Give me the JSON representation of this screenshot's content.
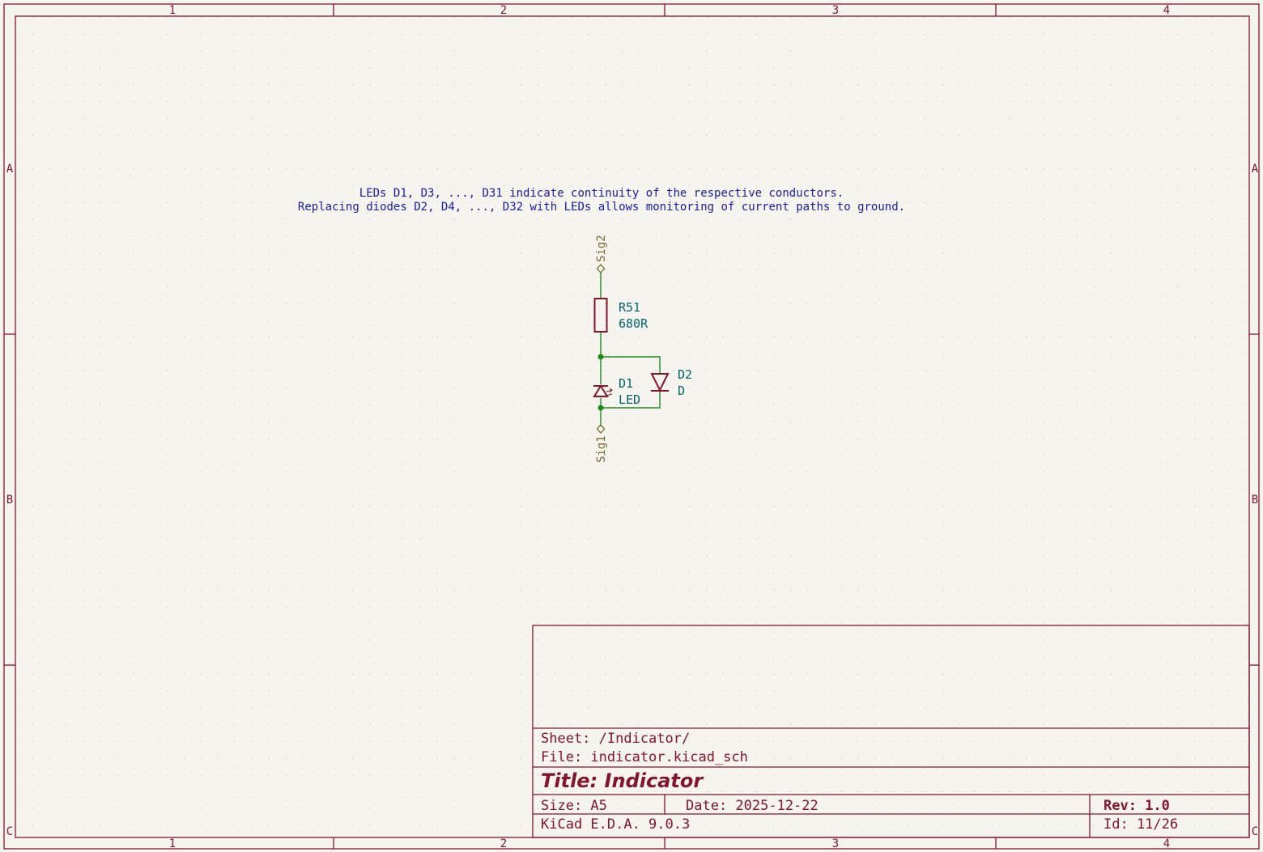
{
  "frame": {
    "columns": [
      "1",
      "2",
      "3",
      "4"
    ],
    "rows": [
      "A",
      "B",
      "C"
    ]
  },
  "note": {
    "line1": "LEDs D1, D3, ..., D31 indicate continuity of the respective conductors.",
    "line2": "Replacing diodes D2, D4, ..., D32 with LEDs allows monitoring of current paths to ground."
  },
  "components": {
    "r51": {
      "ref": "R51",
      "value": "680R"
    },
    "d1": {
      "ref": "D1",
      "value": "LED"
    },
    "d2": {
      "ref": "D2",
      "value": "D"
    }
  },
  "labels": {
    "sig2": "Sig2",
    "sig1": "Sig1"
  },
  "title_block": {
    "sheet": "Sheet: /Indicator/",
    "file": "File: indicator.kicad_sch",
    "title": "Title: Indicator",
    "size": "Size: A5",
    "date": "Date: 2025-12-22",
    "rev": "Rev: 1.0",
    "generator": "KiCad E.D.A. 9.0.3",
    "id": "Id: 11/26"
  },
  "colors": {
    "background": "#f5f4ef",
    "frame": "#84152a",
    "wire": "#1e8a1e",
    "note_text": "#1a1aa6",
    "reference_text": "#00656b",
    "label_text": "#7a6a2a"
  }
}
